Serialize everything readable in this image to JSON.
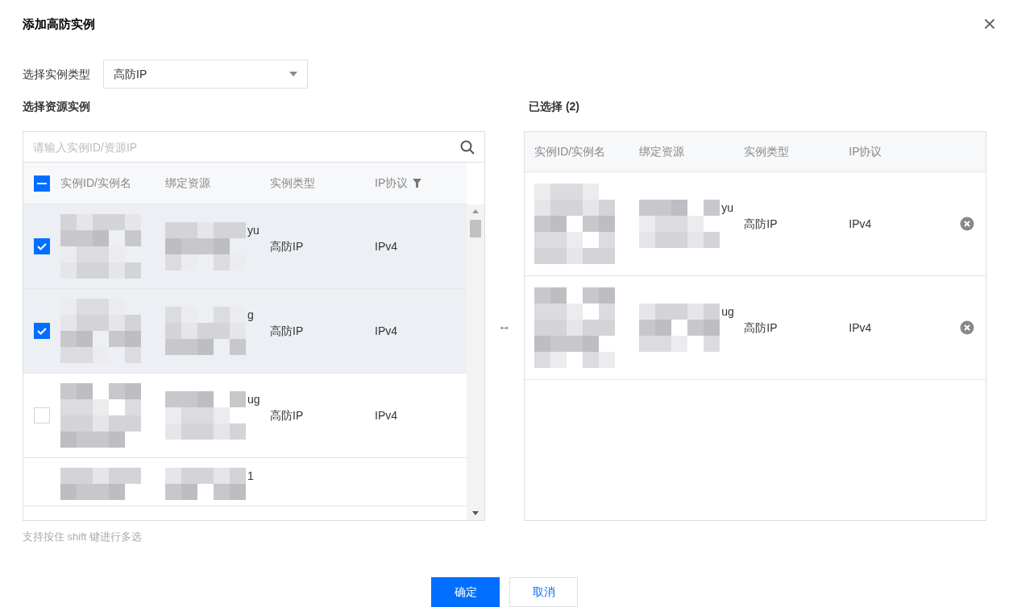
{
  "dialog": {
    "title": "添加高防实例",
    "close": "×"
  },
  "type_select": {
    "label": "选择实例类型",
    "value": "高防IP"
  },
  "source": {
    "title": "选择资源实例",
    "search_placeholder": "请输入实例ID/资源IP",
    "select_all_indeterminate": true,
    "columns": [
      "实例ID/实例名",
      "绑定资源",
      "实例类型",
      "IP协议"
    ],
    "rows": [
      {
        "kind": "full",
        "checked": true,
        "resource_fragment": "yu",
        "type": "高防IP",
        "protocol": "IPv4"
      },
      {
        "kind": "full",
        "checked": true,
        "resource_fragment": "g",
        "type": "高防IP",
        "protocol": "IPv4"
      },
      {
        "kind": "full",
        "checked": false,
        "resource_fragment": "ug",
        "type": "高防IP",
        "protocol": "IPv4"
      },
      {
        "kind": "partial",
        "resource_fragment": "1"
      }
    ]
  },
  "transfer_icon": "↔",
  "selected": {
    "title": "已选择 (2)",
    "columns": [
      "实例ID/实例名",
      "绑定资源",
      "实例类型",
      "IP协议"
    ],
    "rows": [
      {
        "resource_fragment": "yu",
        "type": "高防IP",
        "protocol": "IPv4"
      },
      {
        "resource_fragment": "ug",
        "type": "高防IP",
        "protocol": "IPv4"
      }
    ]
  },
  "hint": "支持按住 shift 键进行多选",
  "buttons": [
    {
      "label": "确定",
      "kind": "primary"
    },
    {
      "label": "取消",
      "kind": "secondary"
    }
  ]
}
